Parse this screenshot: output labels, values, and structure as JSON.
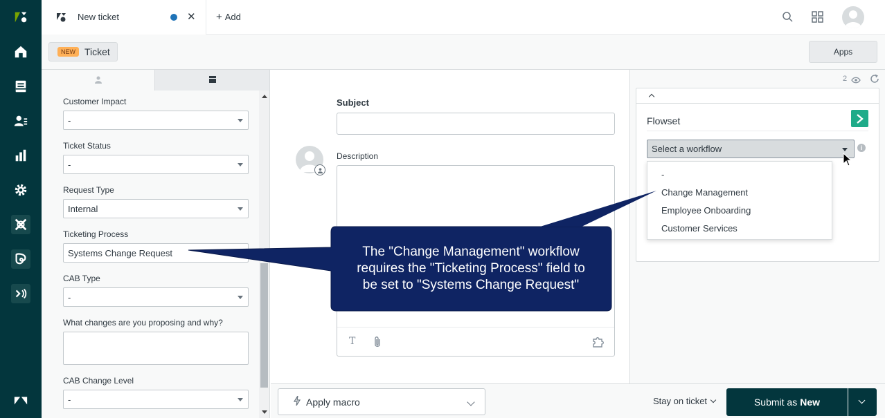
{
  "colors": {
    "rail": "#03363d",
    "accent": "#1f73b7",
    "submit": "#03363d",
    "callout_fill": "#0f2463",
    "new_badge": "#ffb057",
    "flowset_logo": "#1fab89"
  },
  "rail": {
    "icons": [
      "zendesk-logo-icon",
      "home-icon",
      "views-icon",
      "customers-icon",
      "reporting-icon",
      "settings-icon",
      "explore-icon",
      "guide-icon",
      "talk-icon",
      "zendesk-products-icon"
    ]
  },
  "tabs": [
    {
      "title": "New ticket",
      "icon": "ticket-tab-icon",
      "unsaved": true
    }
  ],
  "topbar": {
    "add_label": "Add",
    "icons": [
      "search-icon",
      "product-tray-icon",
      "user-avatar-icon"
    ]
  },
  "subbar": {
    "badge": "NEW",
    "ticket_label": "Ticket",
    "apps_label": "Apps"
  },
  "fields": {
    "tabs": [
      "user-icon",
      "ticket-fields-icon"
    ],
    "items": [
      {
        "label": "Customer Impact",
        "value": "-",
        "kind": "select"
      },
      {
        "label": "Ticket Status",
        "value": "-",
        "kind": "select"
      },
      {
        "label": "Request Type",
        "value": "Internal",
        "kind": "select"
      },
      {
        "label": "Ticketing Process",
        "value": "Systems Change Request",
        "kind": "select"
      },
      {
        "label": "CAB Type",
        "value": "-",
        "kind": "select"
      },
      {
        "label": "What changes are you proposing and why?",
        "value": "",
        "kind": "textarea"
      },
      {
        "label": "CAB Change Level",
        "value": "-",
        "kind": "select"
      }
    ]
  },
  "editor": {
    "subject_label": "Subject",
    "subject_value": "",
    "description_label": "Description",
    "description_value": ""
  },
  "bottom": {
    "macro_label": "Apply macro",
    "stay_label": "Stay on ticket",
    "submit_prefix": "Submit as",
    "submit_status": "New"
  },
  "apps": {
    "viewer_count": "2",
    "app_title": "Flowset",
    "workflow_placeholder": "Select a workflow",
    "workflow_options": [
      "-",
      "Change Management",
      "Employee Onboarding",
      "Customer Services"
    ]
  },
  "callout": {
    "lines": [
      "The \"Change Management\" workflow",
      "requires the \"Ticketing Process\" field to",
      "be set to \"Systems Change Request\""
    ]
  }
}
